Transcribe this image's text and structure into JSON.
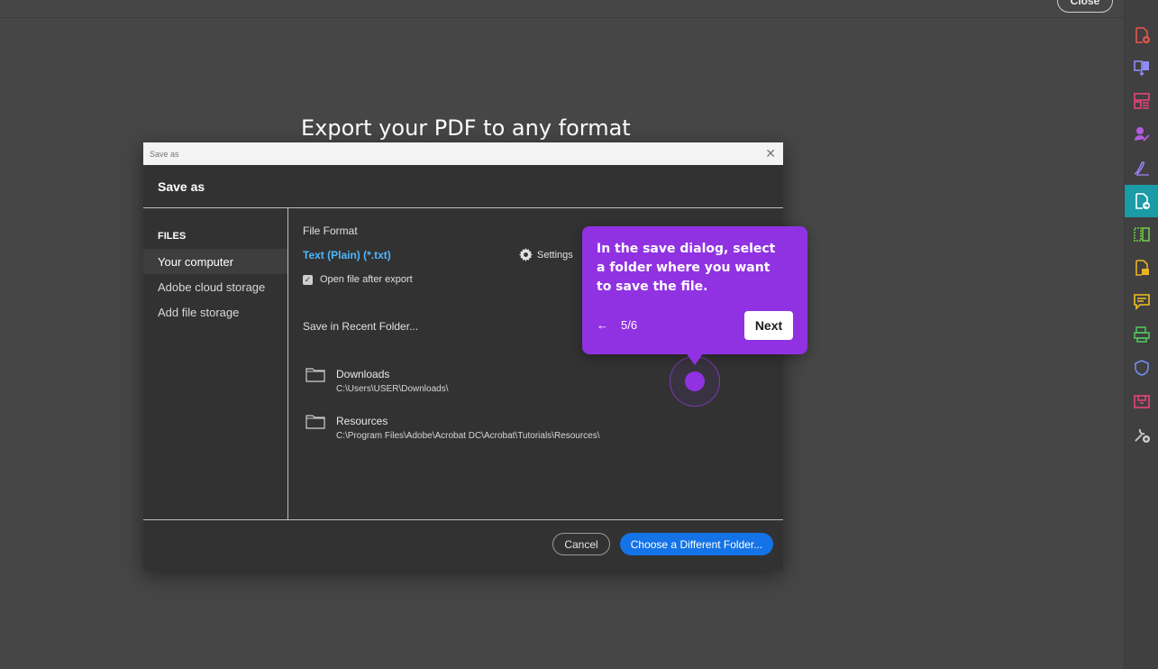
{
  "topbar": {
    "close_label": "Close"
  },
  "headline": "Export your PDF to any format",
  "dialog": {
    "window_title": "Save as",
    "header_title": "Save as",
    "files_heading": "FILES",
    "locations": [
      "Your computer",
      "Adobe cloud storage",
      "Add file storage"
    ],
    "selected_location": "Your computer",
    "file_format_label": "File Format",
    "file_format_value": "Text (Plain) (*.txt)",
    "settings_label": "Settings",
    "open_after_export_label": "Open file after export",
    "open_after_export_checked": true,
    "recent_folder_label": "Save in Recent Folder...",
    "folders": [
      {
        "name": "Downloads",
        "path": "C:\\Users\\USER\\Downloads\\"
      },
      {
        "name": "Resources",
        "path": "C:\\Program Files\\Adobe\\Acrobat DC\\Acrobat\\Tutorials\\Resources\\"
      }
    ],
    "cancel_label": "Cancel",
    "choose_folder_label": "Choose a Different Folder..."
  },
  "tooltip": {
    "text": "In the save dialog, select a folder where you want to save the file.",
    "step": "5/6",
    "next_label": "Next",
    "color": "#9132e2"
  },
  "right_toolbar": {
    "icons": [
      {
        "name": "create-pdf-icon",
        "color": "#e8554e"
      },
      {
        "name": "combine-files-icon",
        "color": "#8f8cf5"
      },
      {
        "name": "organize-pages-icon",
        "color": "#e8447c"
      },
      {
        "name": "request-signatures-icon",
        "color": "#b35ce0"
      },
      {
        "name": "fill-sign-icon",
        "color": "#9a7ff0"
      },
      {
        "name": "export-pdf-icon",
        "color": "#ffffff",
        "active": true
      },
      {
        "name": "edit-pdf-icon",
        "color": "#6dc944"
      },
      {
        "name": "send-for-review-icon",
        "color": "#e8b424"
      },
      {
        "name": "comment-icon",
        "color": "#f0c020"
      },
      {
        "name": "scan-ocr-icon",
        "color": "#4fc45a"
      },
      {
        "name": "protect-icon",
        "color": "#6f8ff0"
      },
      {
        "name": "compress-pdf-icon",
        "color": "#e8447c"
      },
      {
        "name": "more-tools-icon",
        "color": "#cfcfcf"
      }
    ],
    "active_color": "#1a9ba6"
  }
}
